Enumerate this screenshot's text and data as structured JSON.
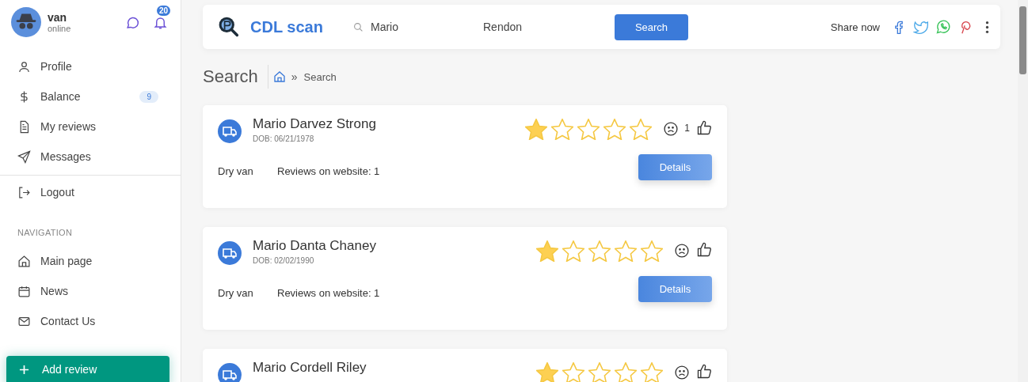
{
  "user": {
    "name": "van",
    "status": "online",
    "notifications": "20"
  },
  "menu": [
    {
      "label": "Profile"
    },
    {
      "label": "Balance",
      "badge": "9"
    },
    {
      "label": "My reviews"
    },
    {
      "label": "Messages"
    }
  ],
  "logout": "Logout",
  "nav_title": "NAVIGATION",
  "nav": [
    {
      "label": "Main page"
    },
    {
      "label": "News"
    },
    {
      "label": "Contact Us"
    }
  ],
  "add_button": "Add review",
  "header": {
    "logo": "CDL scan",
    "first_name": "Mario",
    "last_name": "Rendon",
    "search_button": "Search",
    "share": "Share now"
  },
  "page_title": "Search",
  "breadcrumb": [
    {
      "separator": "»",
      "label": "Search"
    }
  ],
  "results": [
    {
      "name": "Mario Darvez Strong",
      "dob": "DOB: 06/21/1978",
      "stars": 1,
      "dislikes": "1",
      "type": "Dry van",
      "reviews": "Reviews on website: 1",
      "button": "Details"
    },
    {
      "name": "Mario Danta Chaney",
      "dob": "DOB: 02/02/1990",
      "stars": 1,
      "type": "Dry van",
      "reviews": "Reviews on website: 1",
      "button": "Details"
    },
    {
      "name": "Mario Cordell Riley",
      "stars": 1
    }
  ]
}
